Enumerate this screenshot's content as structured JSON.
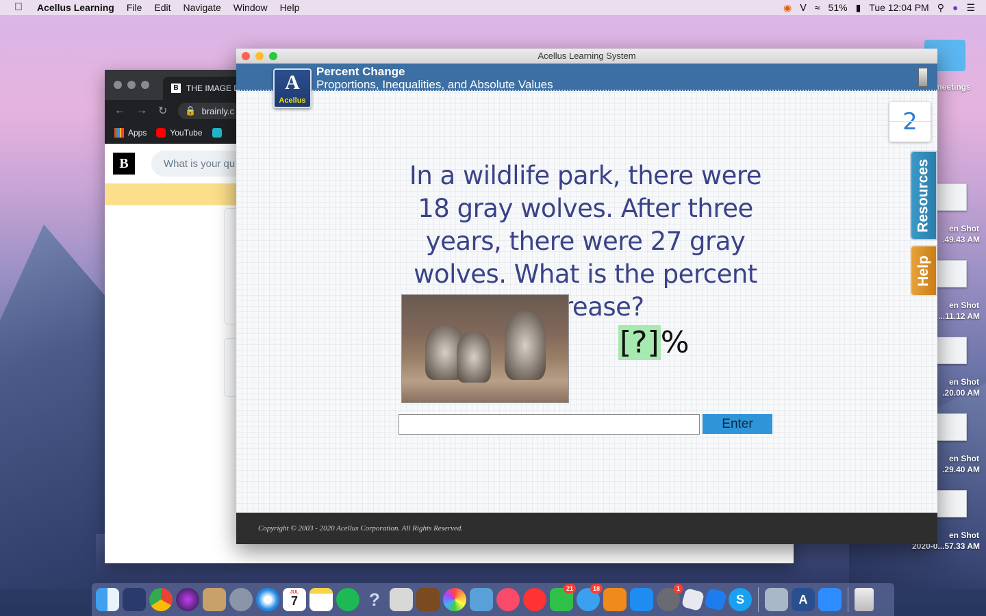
{
  "menubar": {
    "app_name": "Acellus Learning",
    "menus": [
      "File",
      "Edit",
      "Navigate",
      "Window",
      "Help"
    ],
    "battery": "51%",
    "clock": "Tue 12:04 PM"
  },
  "desktop": {
    "folder_label": "meetings",
    "screenshots": [
      {
        "line1": "en Shot",
        "line2": ".49.43 AM"
      },
      {
        "line1": "en Shot",
        "line2": "...11.12 AM"
      },
      {
        "line1": "en Shot",
        "line2": ".20.00 AM"
      },
      {
        "line1": "en Shot",
        "line2": ".29.40 AM"
      },
      {
        "line1": "en Shot",
        "line2": "2020-0...57.33 AM"
      }
    ]
  },
  "chrome": {
    "tab_title": "THE IMAGE D",
    "tab_favicon": "B",
    "url": "brainly.c",
    "bookmarks": [
      "Apps",
      "YouTube"
    ],
    "logo": "B",
    "search_placeholder": "What is your qu"
  },
  "acellus": {
    "window_title": "Acellus Learning System",
    "logo_letter": "A",
    "logo_word": "Acellus",
    "lesson_title": "Percent Change",
    "lesson_subtitle": "Proportions, Inequalities, and Absolute Values",
    "question_counter": "2",
    "question_text": "In a wildlife park, there were 18 gray wolves. After three years, there were 27 gray wolves. What is the percent increase?",
    "answer_blank": "[?]",
    "answer_suffix": "%",
    "answer_value": "",
    "enter_label": "Enter",
    "resources_label": "Resources",
    "help_label": "Help",
    "copyright": "Copyright © 2003 - 2020 Acellus Corporation.  All Rights Reserved."
  },
  "dock": {
    "badges": {
      "facetime": "21",
      "messages": "18",
      "system_prefs": "1"
    },
    "calendar_date": "7",
    "calendar_month": "JUL"
  },
  "colors": {
    "acellus_header": "#3c6fa3",
    "question_text": "#3a4387",
    "enter_button": "#2f95d8",
    "answer_highlight": "#a6eab0",
    "resources_tab": "#2b7cab",
    "help_tab": "#c97e18"
  }
}
